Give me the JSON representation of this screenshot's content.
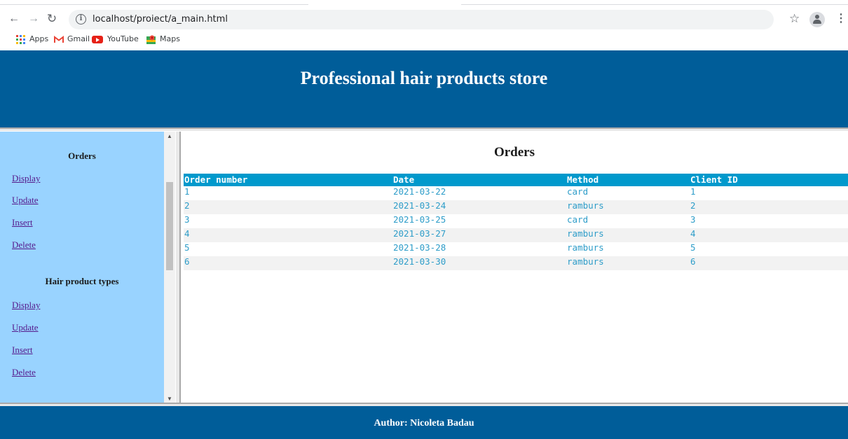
{
  "browser": {
    "url": "localhost/proiect/a_main.html",
    "icons": {
      "back": "back-arrow-icon",
      "forward": "forward-arrow-icon",
      "reload": "reload-icon",
      "info": "info-icon",
      "star": "star-icon",
      "profile": "profile-icon",
      "menu": "kebab-menu-icon"
    },
    "bookmarks": [
      {
        "label": "Apps",
        "icon": "apps-grid-icon"
      },
      {
        "label": "Gmail",
        "icon": "gmail-icon"
      },
      {
        "label": "YouTube",
        "icon": "youtube-icon"
      },
      {
        "label": "Maps",
        "icon": "maps-icon"
      }
    ]
  },
  "header": {
    "title": "Professional hair products store"
  },
  "sidebar": {
    "sections": [
      {
        "heading": "Orders",
        "links": [
          "Display",
          "Update",
          "Insert",
          "Delete"
        ]
      },
      {
        "heading": "Hair product types",
        "links": [
          "Display",
          "Update",
          "Insert",
          "Delete"
        ]
      }
    ]
  },
  "main": {
    "title": "Orders",
    "table": {
      "columns": [
        "Order number",
        "Date",
        "Method",
        "Client ID"
      ],
      "rows": [
        [
          "1",
          "2021-03-22",
          "card",
          "1"
        ],
        [
          "2",
          "2021-03-24",
          "ramburs",
          "2"
        ],
        [
          "3",
          "2021-03-25",
          "card",
          "3"
        ],
        [
          "4",
          "2021-03-27",
          "ramburs",
          "4"
        ],
        [
          "5",
          "2021-03-28",
          "ramburs",
          "5"
        ],
        [
          "6",
          "2021-03-30",
          "ramburs",
          "6"
        ]
      ]
    }
  },
  "footer": {
    "text": "Author: Nicoleta Badau"
  },
  "colors": {
    "header_bg": "#005d99",
    "sidebar_bg": "#99d3ff",
    "table_header_bg": "#0099cc",
    "table_text": "#2e9dc9",
    "link": "#551a8b"
  }
}
